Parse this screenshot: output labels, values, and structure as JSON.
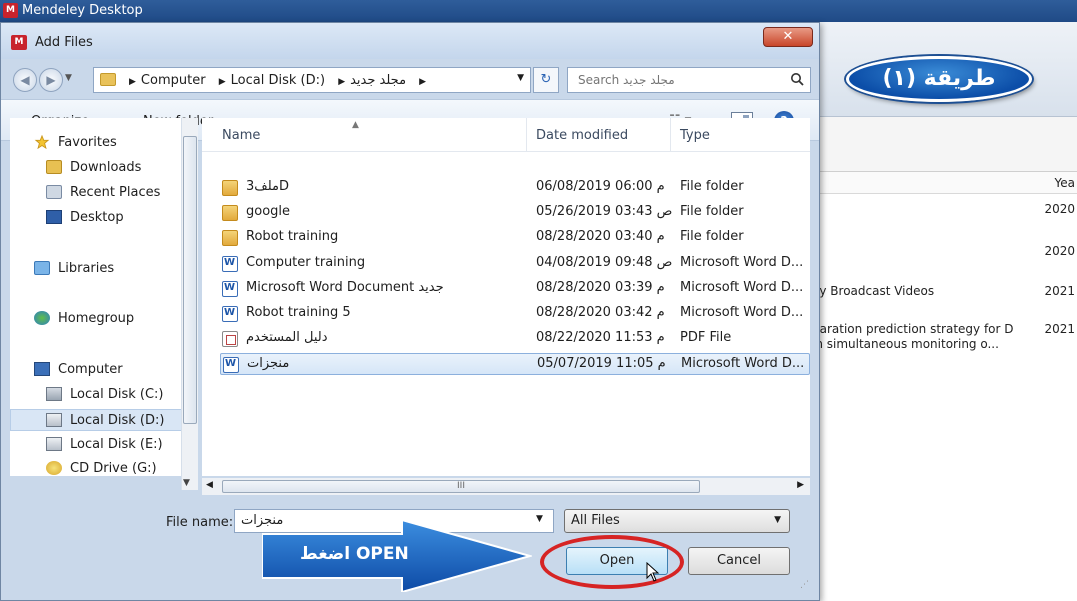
{
  "mendeley": {
    "title": "Mendeley Desktop",
    "year_header": "Yea",
    "rows": [
      {
        "title": "",
        "year": "2020"
      },
      {
        "title": "",
        "year": "2020"
      },
      {
        "title": "ey Broadcast Videos",
        "year": "2021"
      },
      {
        "title": "paration prediction strategy for D in simultaneous monitoring o...",
        "year": "2021"
      }
    ]
  },
  "badge": {
    "text": "طريقة (١)"
  },
  "dialog": {
    "title": "Add Files",
    "close_label": "✕",
    "breadcrumb": [
      "Computer",
      "Local Disk (D:)",
      "مجلد جديد"
    ],
    "search_placeholder": "Search مجلد جديد",
    "organize_label": "Organize ▾",
    "new_folder_label": "New folder",
    "view_label": "☷ ▾",
    "help_label": "?",
    "nav": [
      {
        "label": "Favorites",
        "icon": "star-icon"
      },
      {
        "label": "Downloads",
        "icon": "downloads-folder-icon"
      },
      {
        "label": "Recent Places",
        "icon": "recent-places-icon"
      },
      {
        "label": "Desktop",
        "icon": "desktop-icon"
      },
      {
        "label": "Libraries",
        "icon": "libraries-icon"
      },
      {
        "label": "Homegroup",
        "icon": "homegroup-icon"
      },
      {
        "label": "Computer",
        "icon": "computer-icon"
      },
      {
        "label": "Local Disk (C:)",
        "icon": "disk-icon"
      },
      {
        "label": "Local Disk (D:)",
        "icon": "disk-icon"
      },
      {
        "label": "Local Disk (E:)",
        "icon": "disk-icon"
      },
      {
        "label": "CD Drive (G:)",
        "icon": "cd-drive-icon"
      }
    ],
    "columns": {
      "name": "Name",
      "date": "Date modified",
      "type": "Type"
    },
    "files": [
      {
        "name": "ملف3D",
        "date": "06/08/2019 06:00 م",
        "type": "File folder",
        "kind": "folder"
      },
      {
        "name": "google",
        "date": "05/26/2019 03:43 ص",
        "type": "File folder",
        "kind": "folder"
      },
      {
        "name": "Robot training",
        "date": "08/28/2020 03:40 م",
        "type": "File folder",
        "kind": "folder"
      },
      {
        "name": "Computer training",
        "date": "04/08/2019 09:48 ص",
        "type": "Microsoft Word D...",
        "kind": "word"
      },
      {
        "name": "Microsoft Word Document جديد",
        "date": "08/28/2020 03:39 م",
        "type": "Microsoft Word D...",
        "kind": "word"
      },
      {
        "name": "Robot training 5",
        "date": "08/28/2020 03:42 م",
        "type": "Microsoft Word D...",
        "kind": "word"
      },
      {
        "name": "دليل المستخدم",
        "date": "08/22/2020 11:53 م",
        "type": "PDF File",
        "kind": "pdf"
      },
      {
        "name": "منجزات",
        "date": "05/07/2019 11:05 م",
        "type": "Microsoft Word D...",
        "kind": "word"
      }
    ],
    "filename_label": "File name:",
    "filename_value": "منجزات",
    "filetype_value": "All Files",
    "open_label": "Open",
    "cancel_label": "Cancel"
  },
  "annotation": {
    "arrow_text": "اضغط OPEN"
  },
  "colors": {
    "accent": "#1a5fb4",
    "highlight": "#d62424"
  }
}
